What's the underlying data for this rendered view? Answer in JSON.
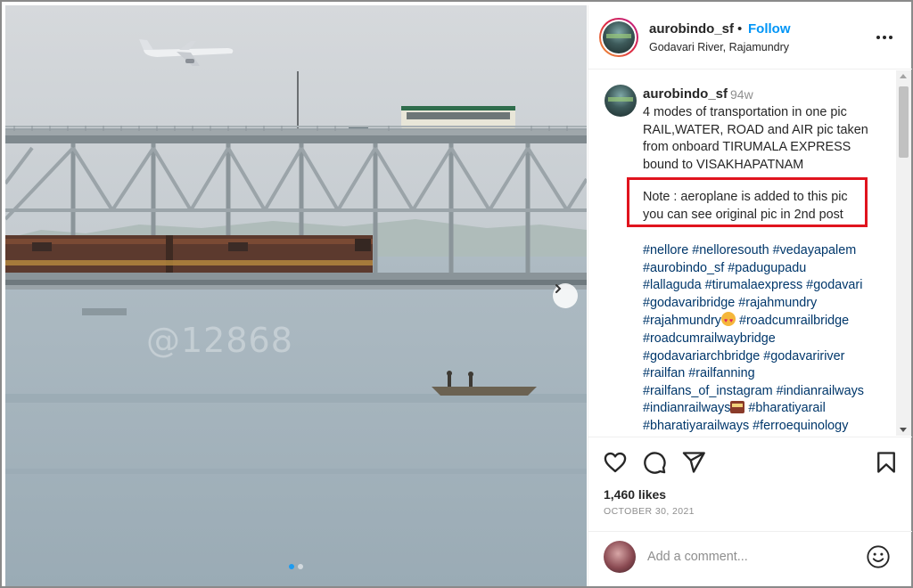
{
  "post": {
    "photo_watermark": "@12868",
    "carousel": {
      "total": 2,
      "current": 1
    }
  },
  "header": {
    "username": "aurobindo_sf",
    "separator": "•",
    "follow_label": "Follow",
    "location": "Godavari River, Rajamundry"
  },
  "caption": {
    "username": "aurobindo_sf",
    "time_ago": "94w",
    "lines": [
      "4 modes of transportation in one pic",
      "RAIL,WATER, ROAD and AIR pic taken",
      "from onboard TIRUMALA EXPRESS",
      "bound to VISAKHAPATNAM"
    ],
    "note_lines": [
      "Note : aeroplane is added to this pic",
      "you can see original pic in 2nd post"
    ],
    "hashtag_lines": [
      "#nellore #nelloresouth #vedayapalem",
      "#aurobindo_sf #padugupadu",
      "#lallaguda #tirumalaexpress #godavari",
      "#godavaribridge #rajahmundry",
      "#rajahmundry",
      "#roadcumrailwaybridge",
      "#godavariarchbridge #godavaririver",
      "#railfan #railfanning",
      "#railfans_of_instagram #indianrailways",
      "#indianrailways",
      "#bharatiyarailways #ferroequinology"
    ],
    "hashtag_line5_after_emoji": " #roadcumrailbridge",
    "hashtag_line10_after_emoji": " #bharatiyarail",
    "note_highlight_color": "#e0141e"
  },
  "actions": {
    "icons": [
      "heart-icon",
      "comment-icon",
      "share-icon",
      "bookmark-icon"
    ],
    "likes": "1,460 likes",
    "date": "OCTOBER 30, 2021"
  },
  "comment": {
    "placeholder": "Add a comment..."
  },
  "colors": {
    "link": "#00376b",
    "follow": "#0095f6",
    "muted": "#8e8e8e"
  }
}
